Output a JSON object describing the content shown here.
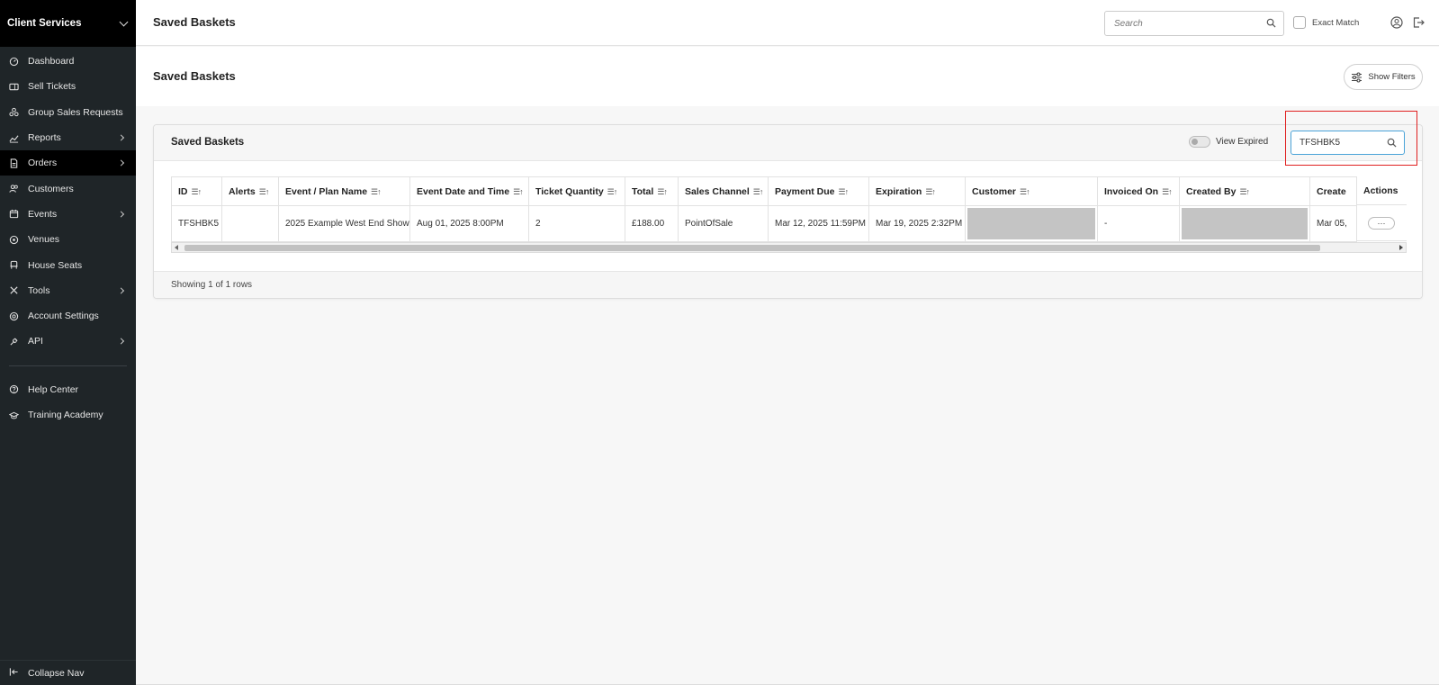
{
  "sidebar": {
    "header": "Client Services",
    "items": [
      {
        "label": "Dashboard",
        "icon": "dashboard-icon",
        "arrow": false,
        "active": false
      },
      {
        "label": "Sell Tickets",
        "icon": "ticket-icon",
        "arrow": false,
        "active": false
      },
      {
        "label": "Group Sales Requests",
        "icon": "group-icon",
        "arrow": false,
        "active": false
      },
      {
        "label": "Reports",
        "icon": "chart-icon",
        "arrow": true,
        "active": false
      },
      {
        "label": "Orders",
        "icon": "document-icon",
        "arrow": true,
        "active": true
      },
      {
        "label": "Customers",
        "icon": "users-icon",
        "arrow": false,
        "active": false
      },
      {
        "label": "Events",
        "icon": "calendar-icon",
        "arrow": true,
        "active": false
      },
      {
        "label": "Venues",
        "icon": "location-pin-icon",
        "arrow": false,
        "active": false
      },
      {
        "label": "House Seats",
        "icon": "seat-icon",
        "arrow": false,
        "active": false
      },
      {
        "label": "Tools",
        "icon": "tools-icon",
        "arrow": true,
        "active": false
      },
      {
        "label": "Account Settings",
        "icon": "settings-icon",
        "arrow": false,
        "active": false
      },
      {
        "label": "API",
        "icon": "plug-icon",
        "arrow": true,
        "active": false
      }
    ],
    "secondary": [
      {
        "label": "Help Center",
        "icon": "help-icon"
      },
      {
        "label": "Training Academy",
        "icon": "graduation-cap-icon"
      }
    ],
    "collapse_label": "Collapse Nav"
  },
  "topbar": {
    "title": "Saved Baskets",
    "search_placeholder": "Search",
    "exact_match_label": "Exact Match"
  },
  "page": {
    "subtitle": "Saved Baskets",
    "filters_label": "Show Filters"
  },
  "card": {
    "title": "Saved Baskets",
    "view_expired_label": "View Expired",
    "search_value": "TFSHBK5",
    "footer": "Showing 1 of 1 rows"
  },
  "table": {
    "columns": [
      "ID",
      "Alerts",
      "Event / Plan Name",
      "Event Date and Time",
      "Ticket Quantity",
      "Total",
      "Sales Channel",
      "Payment Due",
      "Expiration",
      "Customer",
      "Invoiced On",
      "Created By",
      "Create",
      "Actions"
    ],
    "rows": [
      {
        "id": "TFSHBK5",
        "alerts": "",
        "event": "2025 Example West End Show",
        "event_date": "Aug 01, 2025 8:00PM",
        "quantity": "2",
        "total": "£188.00",
        "channel": "PointOfSale",
        "payment_due": "Mar 12, 2025 11:59PM",
        "expiration": "Mar 19, 2025 2:32PM",
        "customer": "",
        "invoiced_on": "-",
        "created_by": "",
        "created": "Mar 05,",
        "actions_label": "···"
      }
    ]
  }
}
